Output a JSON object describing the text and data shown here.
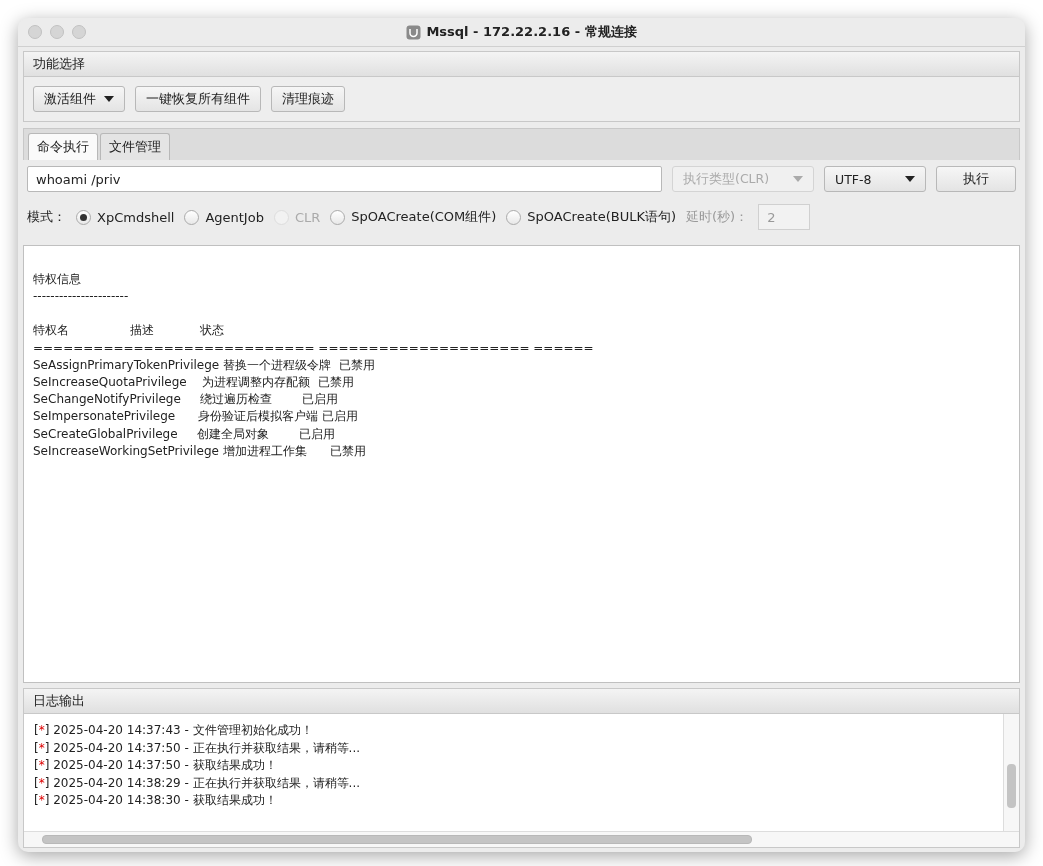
{
  "window": {
    "title": "Mssql - 172.22.2.16 - 常规连接"
  },
  "function_panel": {
    "title": "功能选择",
    "buttons": [
      {
        "label": "激活组件",
        "kind": "dropdown"
      },
      {
        "label": "一键恢复所有组件",
        "kind": "plain"
      },
      {
        "label": "清理痕迹",
        "kind": "plain"
      }
    ]
  },
  "tabs": [
    {
      "label": "命令执行",
      "selected": true
    },
    {
      "label": "文件管理",
      "selected": false
    }
  ],
  "command": {
    "value": "whoami /priv",
    "exec_type": {
      "value": "执行类型(CLR)",
      "disabled": true
    },
    "encoding": {
      "value": "UTF-8",
      "disabled": false
    },
    "run_button": "执行"
  },
  "mode": {
    "label": "模式：",
    "options": [
      {
        "label": "XpCmdshell",
        "selected": true,
        "disabled": false
      },
      {
        "label": "AgentJob",
        "selected": false,
        "disabled": false
      },
      {
        "label": "CLR",
        "selected": false,
        "disabled": true
      },
      {
        "label": "SpOACreate(COM组件)",
        "selected": false,
        "disabled": false
      },
      {
        "label": "SpOACreate(BULK语句)",
        "selected": false,
        "disabled": false
      }
    ],
    "delay_label": "延时(秒)：",
    "delay_value": "2",
    "delay_disabled": true
  },
  "output": {
    "lines": [
      "特权信息",
      "----------------------",
      "特权名                描述            状态",
      "============================ ===================== ======",
      "SeAssignPrimaryTokenPrivilege 替换一个进程级令牌  已禁用",
      "SeIncreaseQuotaPrivilege    为进程调整内存配额  已禁用",
      "SeChangeNotifyPrivilege     绕过遍历检查        已启用",
      "SeImpersonatePrivilege      身份验证后模拟客户端 已启用",
      "SeCreateGlobalPrivilege     创建全局对象        已启用",
      "SeIncreaseWorkingSetPrivilege 增加进程工作集      已禁用"
    ]
  },
  "log": {
    "title": "日志输出",
    "entries": [
      {
        "open": "[",
        "mark": "*",
        "close": "]",
        "text": "2025-04-20 14:37:43 - 文件管理初始化成功！"
      },
      {
        "open": "[",
        "mark": "*",
        "close": "]",
        "text": "2025-04-20 14:37:50 - 正在执行并获取结果，请稍等..."
      },
      {
        "open": "[",
        "mark": "*",
        "close": "]",
        "text": "2025-04-20 14:37:50 - 获取结果成功！"
      },
      {
        "open": "[",
        "mark": "*",
        "close": "]",
        "text": "2025-04-20 14:38:29 - 正在执行并获取结果，请稍等..."
      },
      {
        "open": "[",
        "mark": "*",
        "close": "]",
        "text": "2025-04-20 14:38:30 - 获取结果成功！"
      }
    ]
  }
}
